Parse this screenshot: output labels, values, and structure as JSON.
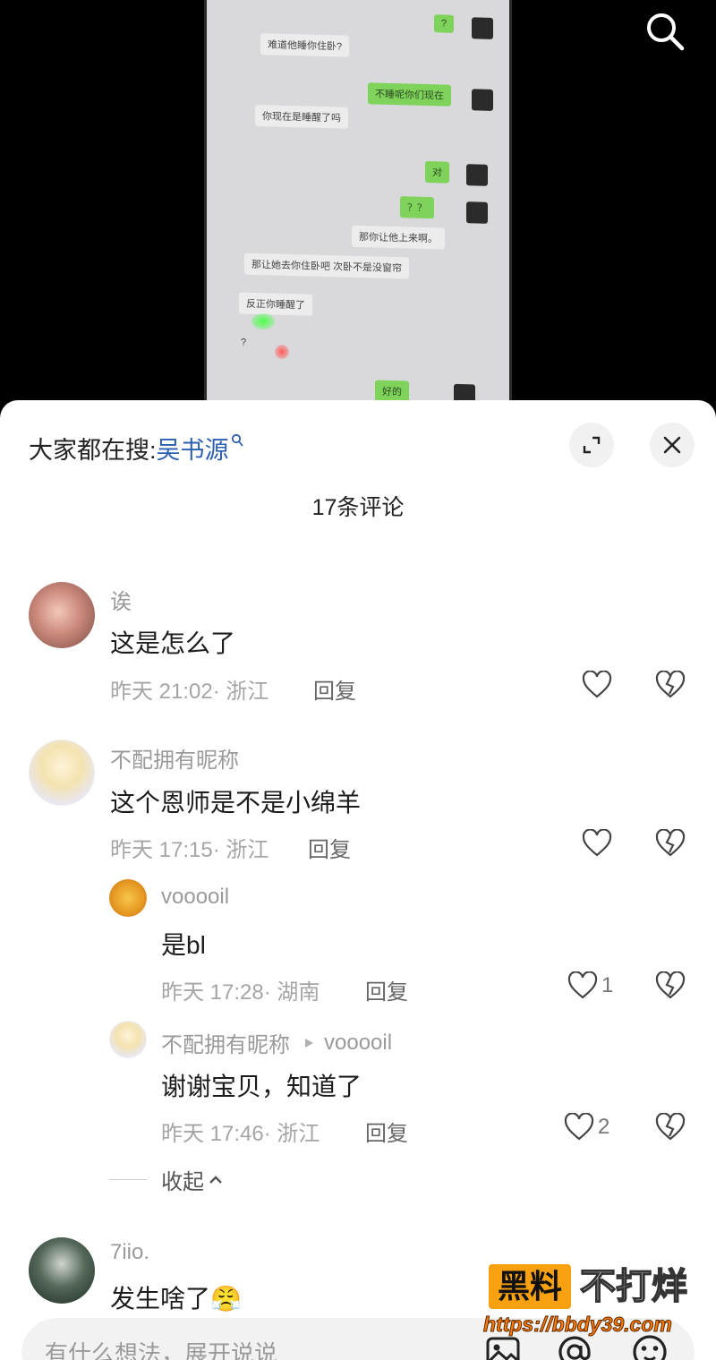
{
  "video": {
    "chat_messages": [
      {
        "side": "right",
        "text": "?"
      },
      {
        "side": "left",
        "text": "难道他睡你住卧?"
      },
      {
        "side": "right",
        "text": "不睡呢你们现在"
      },
      {
        "side": "left",
        "text": "你现在是睡醒了吗"
      },
      {
        "side": "right",
        "text": "对"
      },
      {
        "side": "right",
        "text": "？？"
      },
      {
        "side": "left",
        "text": "那你让他上来啊。"
      },
      {
        "side": "left",
        "text": "那让她去你住卧吧 次卧不是没窗帘"
      },
      {
        "side": "left",
        "text": "反正你睡醒了"
      },
      {
        "side": "left",
        "text": "?"
      },
      {
        "side": "right",
        "text": "好的"
      }
    ]
  },
  "header": {
    "hot_prefix": "大家都在搜:",
    "hot_term": "吴书源",
    "comment_count": "17条评论"
  },
  "comments": [
    {
      "name": "诶",
      "text": "这是怎么了",
      "meta": "昨天 21:02· 浙江",
      "reply": "回复",
      "likes": ""
    },
    {
      "name": "不配拥有昵称",
      "text": "这个恩师是不是小绵羊",
      "meta": "昨天 17:15· 浙江",
      "reply": "回复",
      "likes": "",
      "replies": [
        {
          "name": "vooooil",
          "text": "是bl",
          "meta": "昨天 17:28· 湖南",
          "reply": "回复",
          "likes": "1"
        },
        {
          "name": "不配拥有昵称",
          "reply_to": "vooooil",
          "text": "谢谢宝贝，知道了",
          "meta": "昨天 17:46· 浙江",
          "reply": "回复",
          "likes": "2"
        }
      ],
      "collapse_label": "收起"
    },
    {
      "name": "7iio.",
      "text": "发生啥了",
      "emoji": "😤"
    }
  ],
  "input": {
    "placeholder": "有什么想法，展开说说"
  },
  "watermark": {
    "badge": "黑料",
    "text": "不打烊",
    "url": "https://bbdy39.com"
  },
  "colors": {
    "link_blue": "#2d5fb0",
    "meta_gray": "#a5a5a5",
    "watermark_orange": "#f7a010"
  },
  "icons": [
    "search-icon",
    "expand-icon",
    "close-icon",
    "heart-icon",
    "broken-heart-icon",
    "image-icon",
    "at-icon",
    "emoji-icon",
    "play-triangle-icon",
    "chevron-up-icon"
  ]
}
